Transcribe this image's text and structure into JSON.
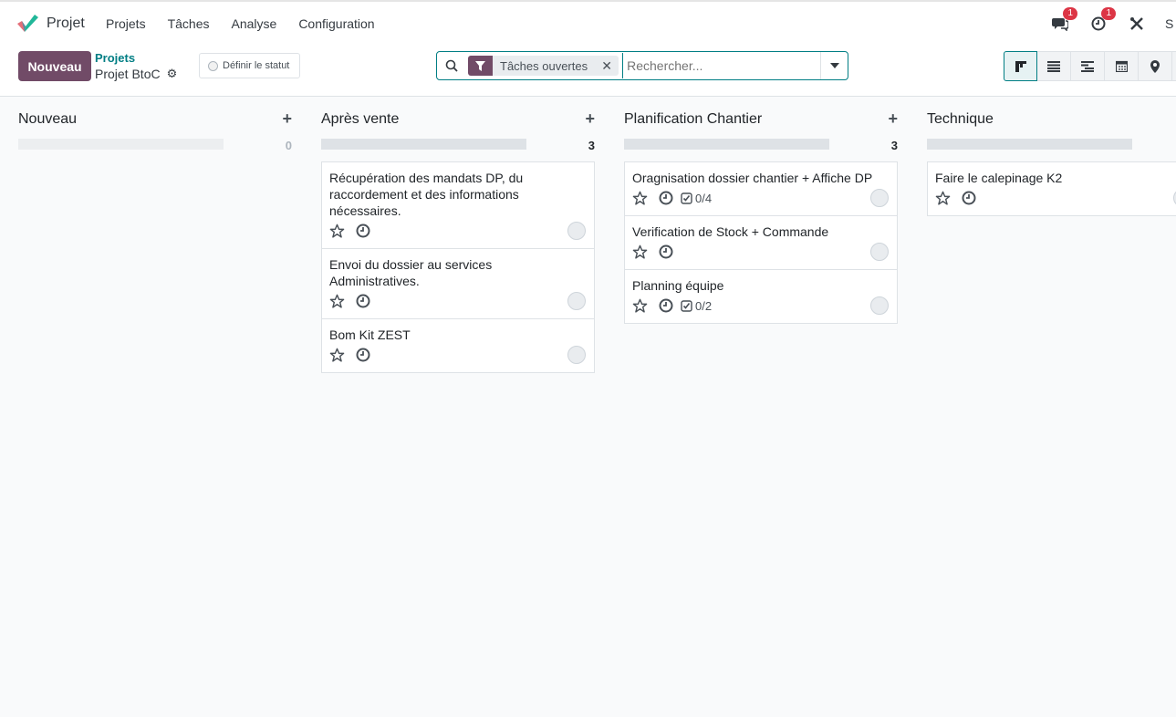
{
  "topbar": {
    "app_name": "Projet",
    "menu": [
      "Projets",
      "Tâches",
      "Analyse",
      "Configuration"
    ],
    "messages_badge": "1",
    "activities_badge": "1",
    "user_initial": "S"
  },
  "control": {
    "new_label": "Nouveau",
    "breadcrumb_parent": "Projets",
    "breadcrumb_current": "Projet BtoC",
    "status_label": "Définir le statut"
  },
  "search": {
    "facet": "Tâches ouvertes",
    "placeholder": "Rechercher..."
  },
  "columns": [
    {
      "title": "Nouveau",
      "count": "0",
      "cards": []
    },
    {
      "title": "Après vente",
      "count": "3",
      "cards": [
        {
          "title": "Récupération des mandats DP, du raccordement et des informations nécessaires.",
          "subtasks": ""
        },
        {
          "title": "Envoi du dossier au services Administratives.",
          "subtasks": ""
        },
        {
          "title": "Bom Kit ZEST",
          "subtasks": ""
        }
      ]
    },
    {
      "title": "Planification Chantier",
      "count": "3",
      "cards": [
        {
          "title": "Oragnisation dossier chantier + Affiche DP",
          "subtasks": "0/4"
        },
        {
          "title": "Verification de Stock + Commande",
          "subtasks": ""
        },
        {
          "title": "Planning équipe",
          "subtasks": "0/2"
        }
      ]
    },
    {
      "title": "Technique",
      "count": "",
      "cards": [
        {
          "title": "Faire le calepinage K2",
          "subtasks": ""
        }
      ]
    }
  ],
  "colors": {
    "brand": "#714b67",
    "accent": "#017e84"
  }
}
